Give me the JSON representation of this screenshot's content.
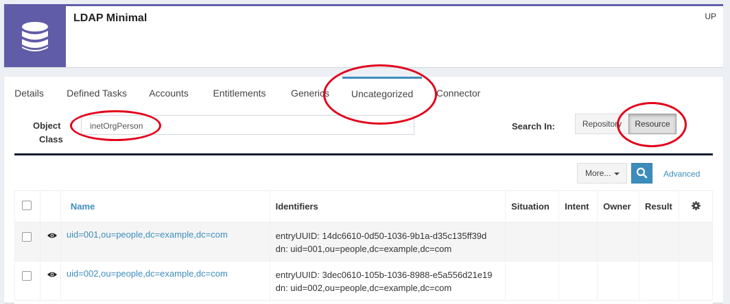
{
  "header": {
    "icon": "database-icon",
    "title": "LDAP Minimal",
    "status": "UP",
    "accent_color": "#605ca8"
  },
  "tabs": [
    {
      "label": "Details"
    },
    {
      "label": "Defined Tasks"
    },
    {
      "label": "Accounts"
    },
    {
      "label": "Entitlements"
    },
    {
      "label": "Generics"
    },
    {
      "label": "Uncategorized",
      "active": true
    },
    {
      "label": "Connector"
    }
  ],
  "filter": {
    "object_class_label_1": "Object",
    "object_class_label_2": "Class",
    "object_class_value": "inetOrgPerson",
    "search_in_label": "Search In:",
    "repository_label": "Repository",
    "resource_label": "Resource",
    "selected": "Resource"
  },
  "toolbar": {
    "more_label": "More...",
    "search_icon": "search-icon",
    "advanced_label": "Advanced"
  },
  "table": {
    "columns": [
      "",
      "",
      "Name",
      "Identifiers",
      "Situation",
      "Intent",
      "Owner",
      "Result",
      "gear-icon"
    ],
    "rows": [
      {
        "name": "uid=001,ou=people,dc=example,dc=com",
        "identifier_1": "entryUUID: 14dc6610-0d50-1036-9b1a-d35c135ff39d",
        "identifier_2": "dn: uid=001,ou=people,dc=example,dc=com"
      },
      {
        "name": "uid=002,ou=people,dc=example,dc=com",
        "identifier_1": "entryUUID: 3dec0610-105b-1036-8988-e5a556d21e19",
        "identifier_2": "dn: uid=002,ou=people,dc=example,dc=com"
      }
    ]
  },
  "annotation_color": "#e2001a"
}
